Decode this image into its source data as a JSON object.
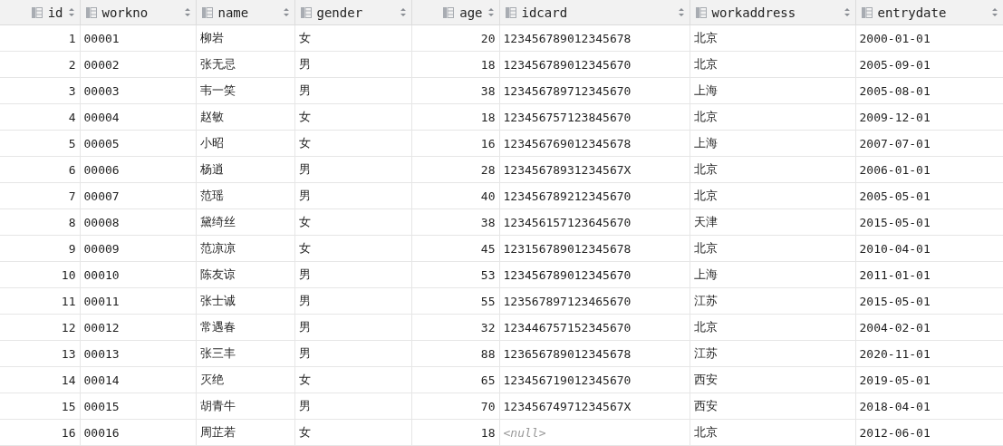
{
  "table": {
    "columns": [
      {
        "label": "id",
        "kind": "number"
      },
      {
        "label": "workno",
        "kind": "text"
      },
      {
        "label": "name",
        "kind": "text"
      },
      {
        "label": "gender",
        "kind": "text"
      },
      {
        "label": "age",
        "kind": "number"
      },
      {
        "label": "idcard",
        "kind": "text"
      },
      {
        "label": "workaddress",
        "kind": "text"
      },
      {
        "label": "entrydate",
        "kind": "text"
      }
    ],
    "rows": [
      [
        "1",
        "00001",
        "柳岩",
        "女",
        "20",
        "123456789012345678",
        "北京",
        "2000-01-01"
      ],
      [
        "2",
        "00002",
        "张无忌",
        "男",
        "18",
        "123456789012345670",
        "北京",
        "2005-09-01"
      ],
      [
        "3",
        "00003",
        "韦一笑",
        "男",
        "38",
        "123456789712345670",
        "上海",
        "2005-08-01"
      ],
      [
        "4",
        "00004",
        "赵敏",
        "女",
        "18",
        "123456757123845670",
        "北京",
        "2009-12-01"
      ],
      [
        "5",
        "00005",
        "小昭",
        "女",
        "16",
        "123456769012345678",
        "上海",
        "2007-07-01"
      ],
      [
        "6",
        "00006",
        "杨逍",
        "男",
        "28",
        "12345678931234567X",
        "北京",
        "2006-01-01"
      ],
      [
        "7",
        "00007",
        "范瑶",
        "男",
        "40",
        "123456789212345670",
        "北京",
        "2005-05-01"
      ],
      [
        "8",
        "00008",
        "黛绮丝",
        "女",
        "38",
        "123456157123645670",
        "天津",
        "2015-05-01"
      ],
      [
        "9",
        "00009",
        "范凉凉",
        "女",
        "45",
        "123156789012345678",
        "北京",
        "2010-04-01"
      ],
      [
        "10",
        "00010",
        "陈友谅",
        "男",
        "53",
        "123456789012345670",
        "上海",
        "2011-01-01"
      ],
      [
        "11",
        "00011",
        "张士诚",
        "男",
        "55",
        "123567897123465670",
        "江苏",
        "2015-05-01"
      ],
      [
        "12",
        "00012",
        "常遇春",
        "男",
        "32",
        "123446757152345670",
        "北京",
        "2004-02-01"
      ],
      [
        "13",
        "00013",
        "张三丰",
        "男",
        "88",
        "123656789012345678",
        "江苏",
        "2020-11-01"
      ],
      [
        "14",
        "00014",
        "灭绝",
        "女",
        "65",
        "123456719012345670",
        "西安",
        "2019-05-01"
      ],
      [
        "15",
        "00015",
        "胡青牛",
        "男",
        "70",
        "12345674971234567X",
        "西安",
        "2018-04-01"
      ],
      [
        "16",
        "00016",
        "周芷若",
        "女",
        "18",
        {
          "text": "<null>",
          "kind": "null"
        },
        "北京",
        "2012-06-01"
      ]
    ]
  }
}
